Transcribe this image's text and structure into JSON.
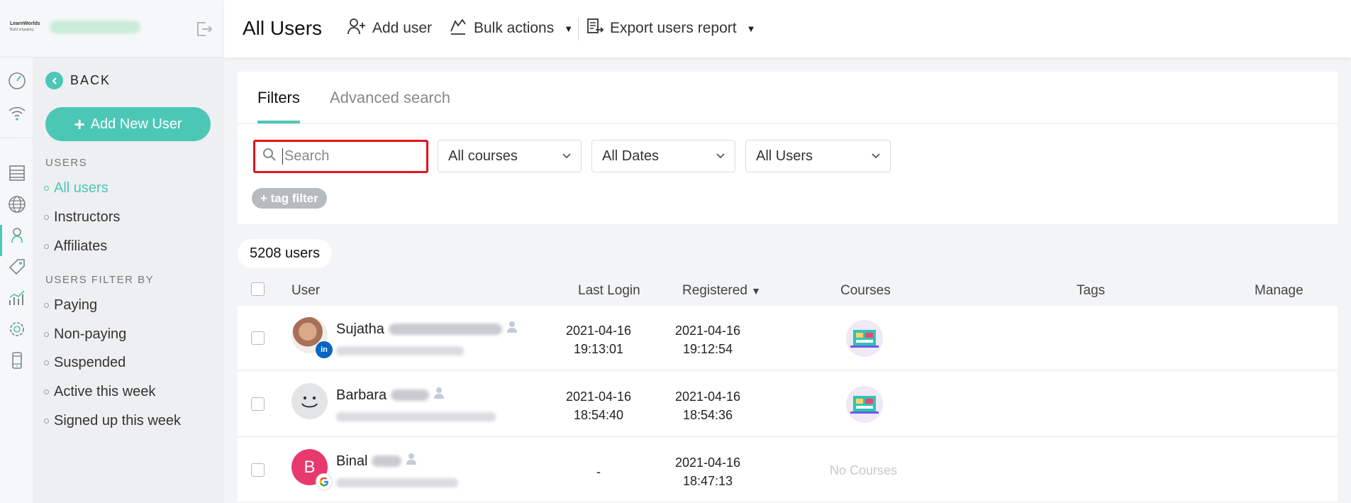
{
  "brand": {
    "logo_text": "LearnWorlds",
    "logo_sub": "Build engaging"
  },
  "header": {
    "title": "All Users",
    "add_user": "Add user",
    "bulk_actions": "Bulk actions",
    "export_report": "Export users report"
  },
  "sidebar": {
    "back": "BACK",
    "add_new_user": "Add New User",
    "users_section": "USERS",
    "users_items": [
      "All users",
      "Instructors",
      "Affiliates"
    ],
    "filter_section": "USERS FILTER BY",
    "filter_items": [
      "Paying",
      "Non-paying",
      "Suspended",
      "Active this week",
      "Signed up this week"
    ]
  },
  "rail_icons": [
    "dashboard-gauge-icon",
    "wifi-icon",
    "pages-icon",
    "globe-icon",
    "users-icon",
    "tag-icon",
    "analytics-icon",
    "settings-icon",
    "mobile-icon"
  ],
  "filters": {
    "tabs": [
      "Filters",
      "Advanced search"
    ],
    "search_placeholder": "Search",
    "courses_select": "All courses",
    "dates_select": "All Dates",
    "users_select": "All Users",
    "tag_filter": "+ tag filter"
  },
  "count_label": "5208 users",
  "table": {
    "columns": {
      "user": "User",
      "last_login": "Last Login",
      "registered": "Registered",
      "courses": "Courses",
      "tags": "Tags",
      "manage": "Manage"
    },
    "sort_indicator": "▼",
    "rows": [
      {
        "first_name": "Sujatha",
        "last_login_date": "2021-04-16",
        "last_login_time": "19:13:01",
        "registered_date": "2021-04-16",
        "registered_time": "19:12:54",
        "courses": "",
        "badge": "in",
        "badge_color": "#0a66c2"
      },
      {
        "first_name": "Barbara",
        "last_login_date": "2021-04-16",
        "last_login_time": "18:54:40",
        "registered_date": "2021-04-16",
        "registered_time": "18:54:36",
        "courses": "",
        "badge": "",
        "badge_color": ""
      },
      {
        "first_name": "Binal",
        "avatar_letter": "B",
        "last_login_date": "-",
        "last_login_time": "",
        "registered_date": "2021-04-16",
        "registered_time": "18:47:13",
        "courses": "No Courses",
        "badge": "G",
        "badge_color": "#ffffff"
      }
    ]
  },
  "colors": {
    "accent": "#4cc7b6",
    "highlight_border": "#e0141d",
    "avatar_pink": "#e8396f"
  }
}
